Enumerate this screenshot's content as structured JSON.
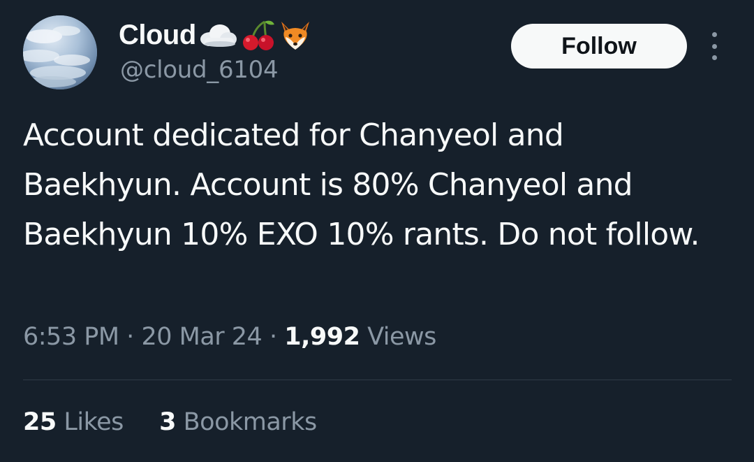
{
  "profile": {
    "display_name": "Cloud",
    "handle": "@cloud_6104",
    "name_emojis": [
      "cloud-emoji",
      "cherries-emoji",
      "fox-emoji"
    ]
  },
  "actions": {
    "follow_label": "Follow",
    "more_icon": "more-vertical-icon"
  },
  "tweet": {
    "text": "Account dedicated for Chanyeol and Baekhyun. Account is 80% Chanyeol and Baekhyun 10% EXO 10% rants. Do not follow.",
    "time": "6:53 PM",
    "separator": "·",
    "date": "20 Mar 24",
    "views_count": "1,992",
    "views_label": "Views"
  },
  "engagement": {
    "likes_count": "25",
    "likes_label": "Likes",
    "bookmarks_count": "3",
    "bookmarks_label": "Bookmarks"
  },
  "colors": {
    "background": "#16202b",
    "primary_text": "#f7f9f9",
    "secondary_text": "#8b98a5",
    "button_bg": "#f7f9f9",
    "button_text": "#0f1419"
  }
}
